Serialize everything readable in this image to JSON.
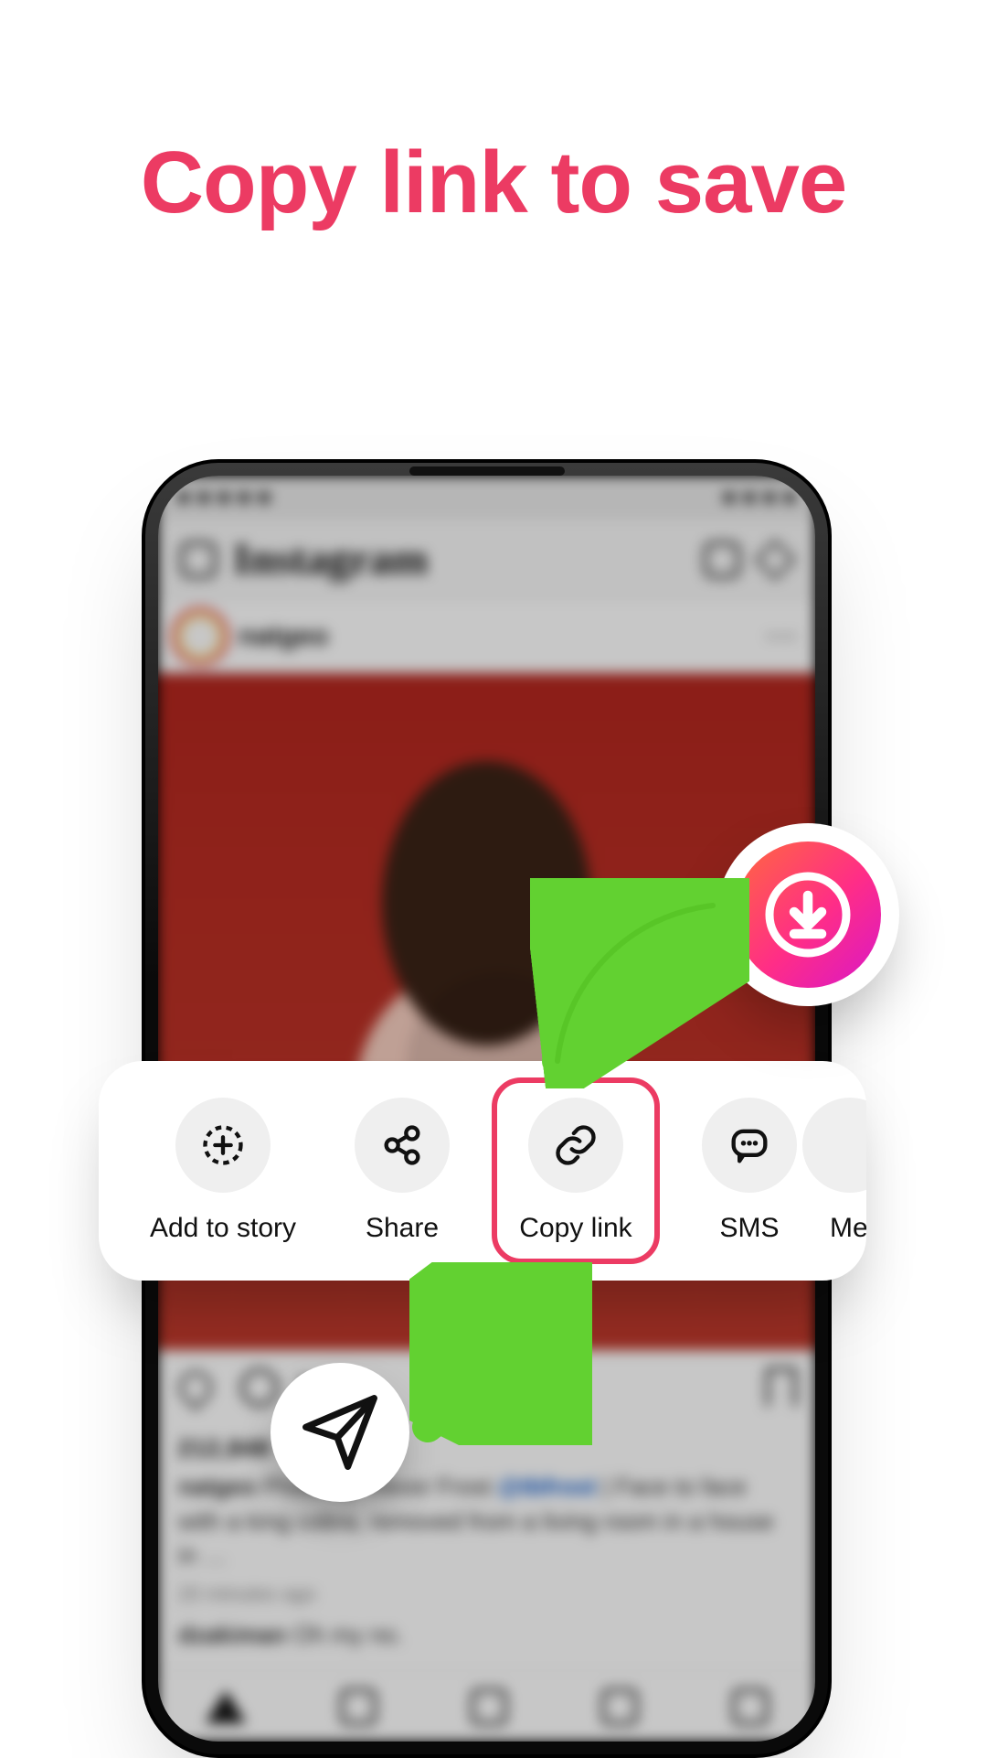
{
  "headline": "Copy link to save",
  "ig": {
    "logo": "Instagram",
    "username": "natgeo",
    "likes": "212,848",
    "caption_user": "natgeo",
    "caption_text_before": " Photo by Trevor Frost ",
    "caption_tag": "@tbfrost",
    "caption_text_after": " | Face to face with a king cobra, removed from a living room in a house in …",
    "timestamp": "20 minutes ago",
    "comment_user": "dzakiman",
    "comment_text": " Oh my no."
  },
  "sheet": {
    "items": [
      {
        "id": "add-story",
        "label": "Add to story"
      },
      {
        "id": "share",
        "label": "Share"
      },
      {
        "id": "copy-link",
        "label": "Copy link",
        "highlight": true
      },
      {
        "id": "sms",
        "label": "SMS"
      },
      {
        "id": "me",
        "label": "Me"
      }
    ]
  }
}
